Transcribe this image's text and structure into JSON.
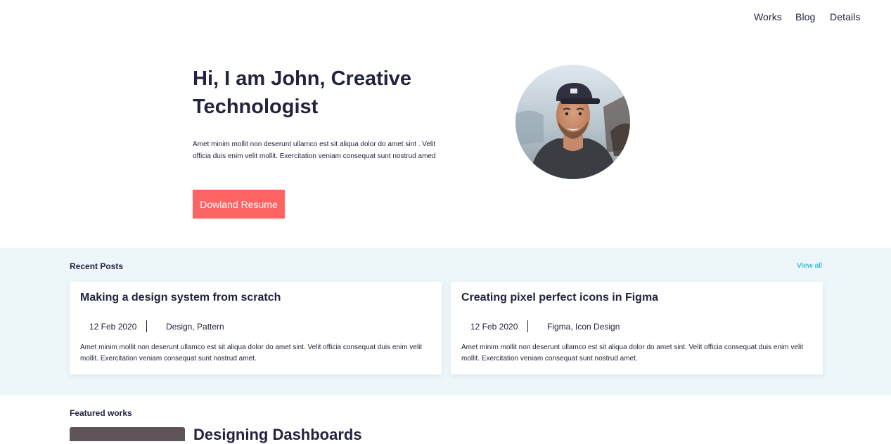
{
  "nav": {
    "links": [
      "Works",
      "Blog",
      "Details"
    ]
  },
  "hero": {
    "title_line1": "Hi, I am John, Creative",
    "title_line2": "Technologist",
    "description": "Amet minim mollit non deserunt ullamco est sit aliqua dolor do amet sint . Velit officia duis enim velit mollit. Exercitation veniam consequat sunt nostrud amed",
    "button_label": "Dowland Resume"
  },
  "recent_posts": {
    "title": "Recent Posts",
    "view_all": "View all",
    "posts": [
      {
        "title": "Making a design system from scratch",
        "date": "12 Feb 2020",
        "tags": "Design, Pattern",
        "excerpt": "Amet minim mollit non deserunt ullamco est sit aliqua dolor do amet sint. Velit officia consequat duis enim velit mollit. Exercitation veniam consequat sunt nostrud amet."
      },
      {
        "title": "Creating pixel perfect icons in Figma",
        "date": "12 Feb 2020",
        "tags": "Figma, Icon Design",
        "excerpt": "Amet minim mollit non deserunt ullamco est sit aliqua dolor do amet sint. Velit officia consequat duis enim velit mollit. Exercitation veniam consequat sunt nostrud amet."
      }
    ]
  },
  "featured": {
    "title": "Featured works",
    "first_work_title": "Designing Dashboards"
  },
  "colors": {
    "primary_text": "#21243d",
    "accent": "#ff6464",
    "link": "#00a8cc",
    "section_bg": "#edf7fa"
  }
}
